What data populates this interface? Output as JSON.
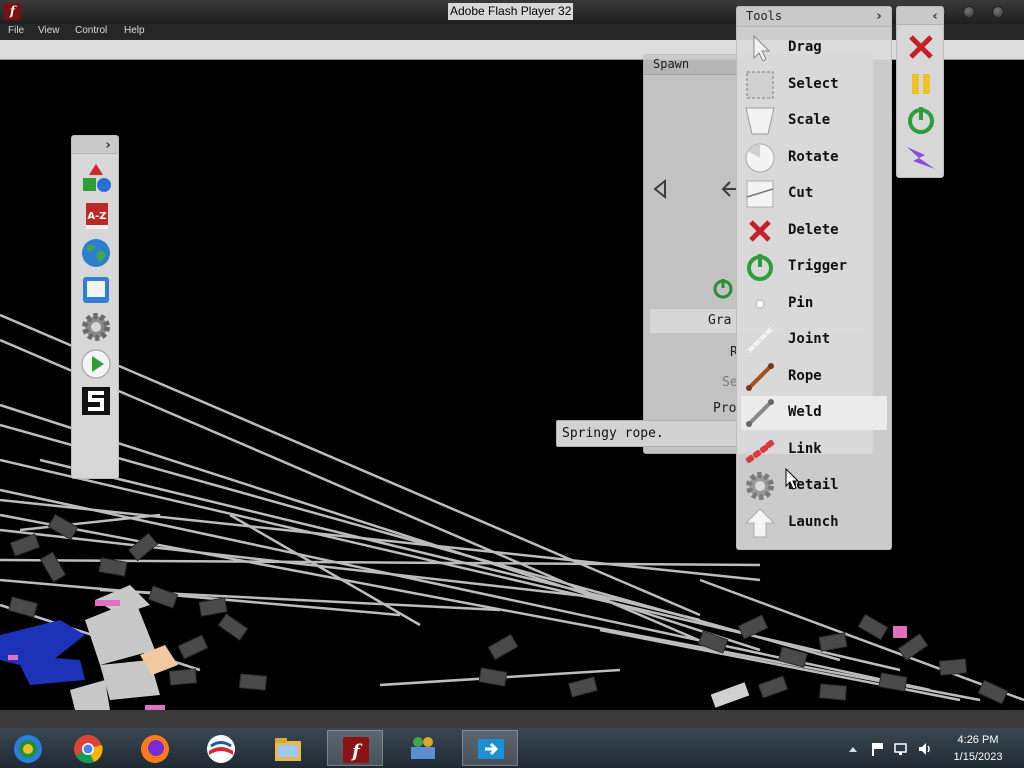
{
  "window": {
    "title": "Adobe Flash Player 32",
    "app_icon": "flash-player-icon",
    "controls": [
      "minimize-icon",
      "maximize-icon",
      "close-icon"
    ]
  },
  "menu": {
    "items": [
      "File",
      "View",
      "Control",
      "Help"
    ]
  },
  "left_toolbar": {
    "icons": [
      "spawn-shapes-icon",
      "catalog-a-z-icon",
      "world-globe-icon",
      "save-disk-icon",
      "settings-gear-icon",
      "play-icon",
      "logo-s-icon"
    ]
  },
  "spawn_panel": {
    "title": "Spawn",
    "rows": [
      "Grapple Gun",
      "Random",
      "Selected",
      "Props"
    ],
    "visible_rows": [
      "Gra",
      "R",
      "Se",
      "Pro"
    ]
  },
  "tooltip": {
    "text": "Springy rope."
  },
  "tools_panel": {
    "title": "Tools",
    "items": [
      {
        "label": "Drag",
        "icon": "drag-cursor-icon"
      },
      {
        "label": "Select",
        "icon": "select-box-icon"
      },
      {
        "label": "Scale",
        "icon": "scale-icon"
      },
      {
        "label": "Rotate",
        "icon": "rotate-icon"
      },
      {
        "label": "Cut",
        "icon": "cut-icon"
      },
      {
        "label": "Delete",
        "icon": "delete-x-icon"
      },
      {
        "label": "Trigger",
        "icon": "trigger-power-icon"
      },
      {
        "label": "Pin",
        "icon": "pin-icon"
      },
      {
        "label": "Joint",
        "icon": "joint-icon"
      },
      {
        "label": "Rope",
        "icon": "rope-icon"
      },
      {
        "label": "Weld",
        "icon": "weld-icon"
      },
      {
        "label": "Link",
        "icon": "link-icon"
      },
      {
        "label": "Detail",
        "icon": "detail-gear-icon"
      },
      {
        "label": "Launch",
        "icon": "launch-arrow-icon"
      }
    ],
    "hovered": "Weld"
  },
  "right_toolbar": {
    "icons": [
      "clear-x-icon",
      "pause-icon",
      "power-icon",
      "lightning-icon"
    ]
  },
  "taskbar": {
    "apps": [
      "chrome-browser-icon",
      "google-chrome-icon",
      "firefox-icon",
      "obama-logo-icon",
      "file-explorer-icon",
      "flash-player-icon",
      "network-users-icon",
      "remote-desktop-icon"
    ],
    "active_app": "flash-player-icon",
    "tray": [
      "show-hidden-icon",
      "flag-icon",
      "network-icon",
      "volume-icon"
    ],
    "time": "4:26 PM",
    "date": "1/15/2023"
  },
  "colors": {
    "scene_background": "#000000",
    "panel": "#d7d7d7",
    "delete_red": "#c8202a",
    "trigger_green": "#2e9e3a",
    "lightning_purple": "#8a4be0",
    "pause_yellow": "#f0c22a",
    "rope_brown": "#a3521a",
    "link_red": "#d83a3a",
    "ragdoll_blue": "#1c33b8",
    "ragdoll_gray": "#c8c8c8",
    "accent_pink": "#e070c0"
  }
}
